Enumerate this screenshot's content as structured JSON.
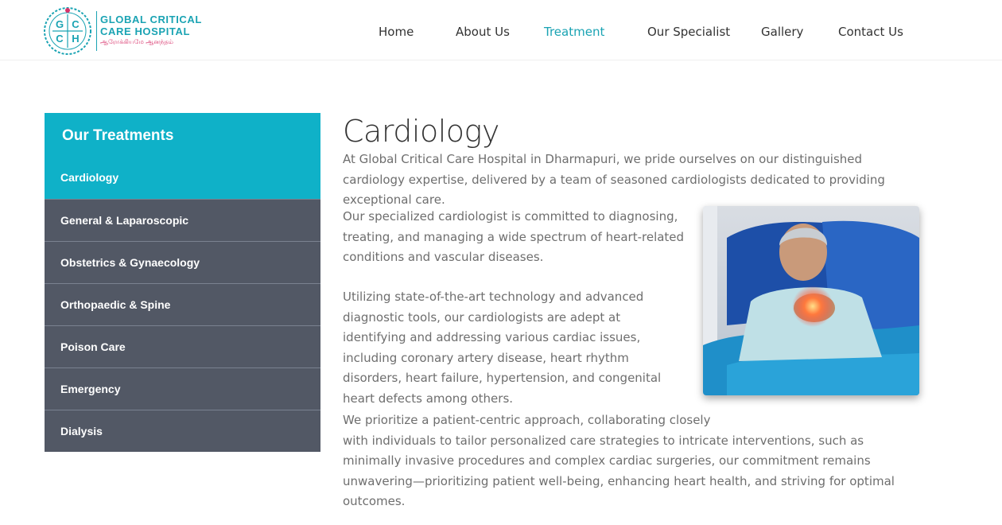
{
  "brand": {
    "logo_letters": [
      "G",
      "C",
      "C",
      "H"
    ],
    "name_line1": "GLOBAL CRITICAL",
    "name_line2": "CARE HOSPITAL",
    "tagline_tamil": "ஆரோக்கியமே ஆனந்தம்",
    "accent_color": "#1aa3b3",
    "tagline_color": "#d8336b"
  },
  "nav": {
    "items": [
      {
        "label": "Home",
        "active": false
      },
      {
        "label": "About Us",
        "active": false
      },
      {
        "label": "Treatment",
        "active": true
      },
      {
        "label": "Our Specialist",
        "active": false
      },
      {
        "label": "Gallery",
        "active": false
      },
      {
        "label": "Contact Us",
        "active": false
      }
    ]
  },
  "sidebar": {
    "title": "Our Treatments",
    "items": [
      {
        "label": "Cardiology",
        "active": true
      },
      {
        "label": "General & Laparoscopic",
        "active": false
      },
      {
        "label": "Obstetrics & Gynaecology",
        "active": false
      },
      {
        "label": "Orthopaedic & Spine",
        "active": false
      },
      {
        "label": "Poison Care",
        "active": false
      },
      {
        "label": "Emergency",
        "active": false
      },
      {
        "label": "Dialysis",
        "active": false
      }
    ],
    "active_color": "#0fb1c8",
    "item_color": "#525865"
  },
  "content": {
    "title": "Cardiology",
    "intro": "At Global Critical Care Hospital in Dharmapuri, we pride ourselves on our distinguished cardiology expertise, delivered by a team of seasoned cardiologists dedicated to providing exceptional care.",
    "para1": "Our specialized cardiologist is committed to diagnosing, treating, and managing a wide spectrum of heart-related conditions and vascular diseases.",
    "para2": "Utilizing state-of-the-art technology and advanced diagnostic tools, our cardiologists are adept at identifying and addressing various cardiac issues, including coronary artery disease, heart rhythm disorders, heart failure, hypertension, and congenital heart defects among others.",
    "para3_line1": "We prioritize a patient-centric approach, collaborating closely",
    "para3_rest": "with individuals to tailor personalized care strategies to intricate interventions, such as minimally invasive procedures and complex cardiac surgeries, our commitment remains unwavering—prioritizing patient well-being, enhancing heart health, and striving for optimal outcomes."
  }
}
